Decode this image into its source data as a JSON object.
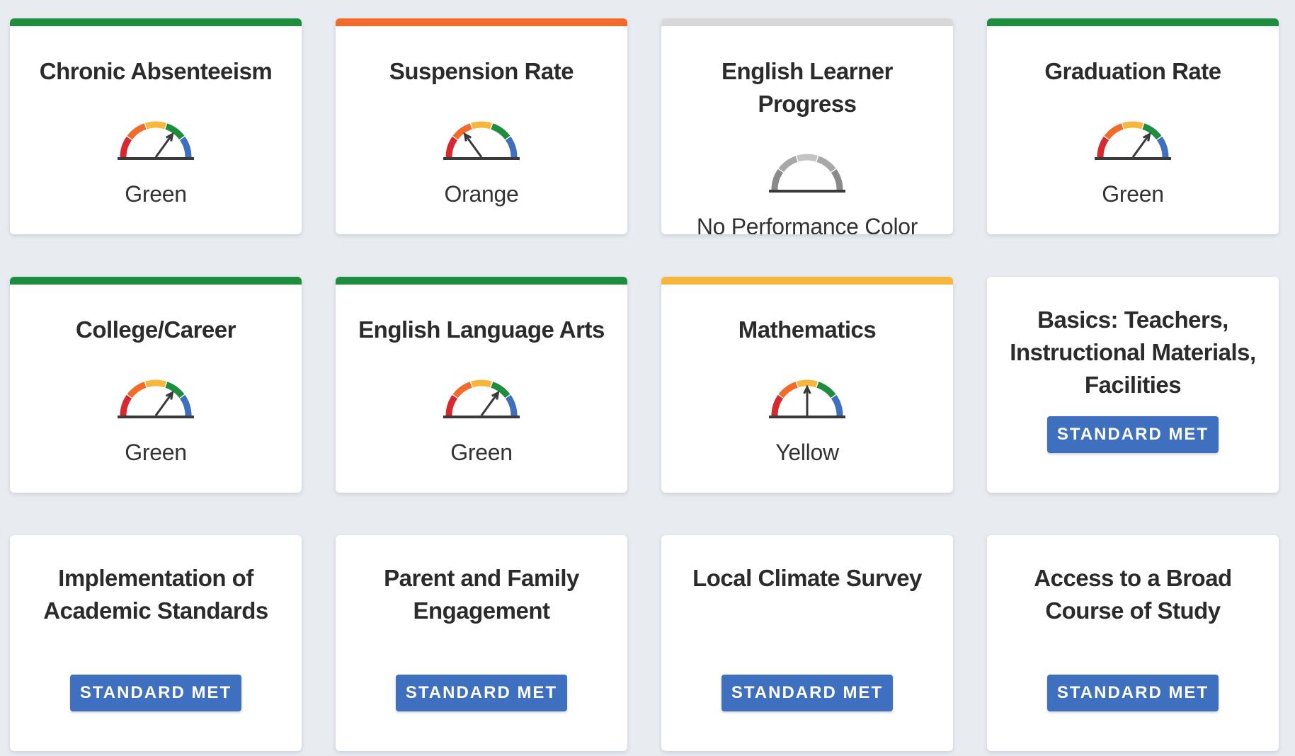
{
  "colors": {
    "green": "#1e8e3e",
    "orange": "#f26b2a",
    "yellow": "#f6b73c",
    "none": "#d9d9d9",
    "badge": "#3f6fbf",
    "gauge_red": "#d7282f",
    "gauge_orange": "#f26b2a",
    "gauge_yellow": "#f6b73c",
    "gauge_green": "#1e8e3e",
    "gauge_blue": "#3f6fbf",
    "gauge_gray": "#8a8a8a"
  },
  "indicators": [
    {
      "title": "Chronic Absenteeism",
      "status": "Green",
      "bar_color": "green",
      "level": 4,
      "icon": "gauge-icon"
    },
    {
      "title": "Suspension Rate",
      "status": "Orange",
      "bar_color": "orange",
      "level": 2,
      "icon": "gauge-icon"
    },
    {
      "title": "English Learner Progress",
      "status": "No Performance Color",
      "bar_color": "none",
      "level": 0,
      "icon": "gauge-icon"
    },
    {
      "title": "Graduation Rate",
      "status": "Green",
      "bar_color": "green",
      "level": 4,
      "icon": "gauge-icon"
    },
    {
      "title": "College/Career",
      "status": "Green",
      "bar_color": "green",
      "level": 4,
      "icon": "gauge-icon"
    },
    {
      "title": "English Language Arts",
      "status": "Green",
      "bar_color": "green",
      "level": 4,
      "icon": "gauge-icon"
    },
    {
      "title": "Mathematics",
      "status": "Yellow",
      "bar_color": "yellow",
      "level": 3,
      "icon": "gauge-icon"
    }
  ],
  "local_indicators": [
    {
      "title": "Basics: Teachers, Instructional Materials, Facilities",
      "badge": "STANDARD MET"
    },
    {
      "title": "Implementation of Academic Standards",
      "badge": "STANDARD MET"
    },
    {
      "title": "Parent and Family Engagement",
      "badge": "STANDARD MET"
    },
    {
      "title": "Local Climate Survey",
      "badge": "STANDARD MET"
    },
    {
      "title": "Access to a Broad Course of Study",
      "badge": "STANDARD MET"
    }
  ]
}
